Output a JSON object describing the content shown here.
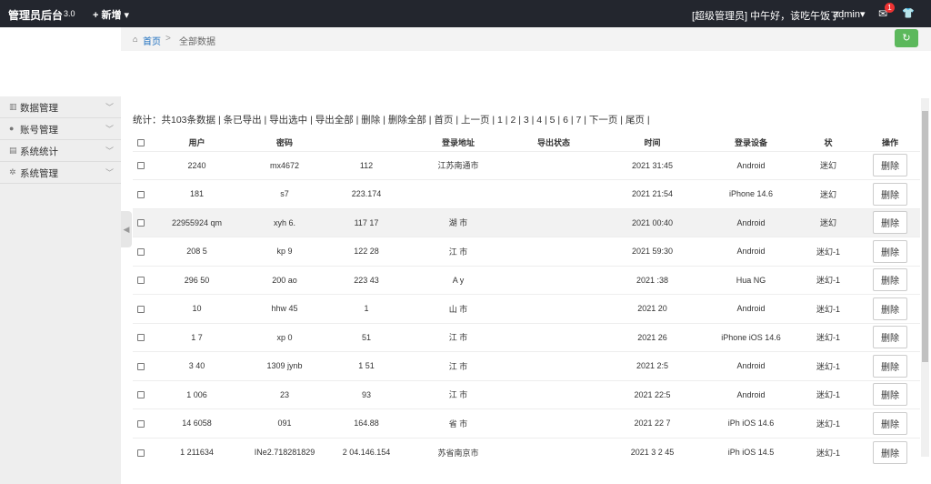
{
  "topbar": {
    "brand": "管理员后台",
    "version": "3.0",
    "new_label": "+ 新增 ▾",
    "greeting": "[超级管理员] 中午好，该吃午饭了！",
    "admin": "admin▾",
    "badge_count": "1"
  },
  "breadcrumb": {
    "home": "首页",
    "separator": ">",
    "current": "全部数据"
  },
  "sidebar": {
    "items": [
      {
        "label": "数据管理",
        "icon": "chart-icon"
      },
      {
        "label": "账号管理",
        "icon": "user-icon"
      },
      {
        "label": "系统统计",
        "icon": "stats-icon"
      },
      {
        "label": "系统管理",
        "icon": "gear-icon"
      }
    ]
  },
  "stats": {
    "count": "统计：共103条数据",
    "links": [
      "条已导出",
      "导出选中",
      "导出全部",
      "删除",
      "删除全部",
      "首页",
      "上一页",
      "1",
      "2",
      "3",
      "4",
      "5",
      "6",
      "7",
      "下一页",
      "尾页"
    ]
  },
  "table": {
    "headers": [
      "用户",
      "密码",
      "",
      "登录地址",
      "导出状态",
      "时间",
      "登录设备",
      "状",
      "操作"
    ],
    "delete_label": "删除",
    "rows": [
      [
        "2240",
        "mx4672",
        "112",
        "江苏南通市",
        "",
        "2021 31:45",
        "Android",
        "迷幻",
        ""
      ],
      [
        "181",
        "s7",
        "223.174",
        "",
        "",
        "2021 21:54",
        "iPhone 14.6",
        "迷幻",
        ""
      ],
      [
        "22955924 qm",
        "xyh 6.",
        "117 17",
        "湖 市",
        "",
        "2021 00:40",
        "Android",
        "迷幻",
        ""
      ],
      [
        "208 5",
        "kp 9",
        "122 28",
        "江 市",
        "",
        "2021 59:30",
        "Android",
        "迷幻-1",
        ""
      ],
      [
        "296 50",
        "200 ao",
        "223 43",
        "A y",
        "",
        "2021 :38",
        "Hua NG",
        "迷幻-1",
        ""
      ],
      [
        "10",
        "hhw 45",
        "1",
        "山 市",
        "",
        "2021 20",
        "Android",
        "迷幻-1",
        ""
      ],
      [
        "1 7",
        "xp 0",
        "51",
        "江 市",
        "",
        "2021 26",
        "iPhone iOS 14.6",
        "迷幻-1",
        ""
      ],
      [
        "3 40",
        "1309 jynb",
        "1 51",
        "江 市",
        "",
        "2021 2:5",
        "Android",
        "迷幻-1",
        ""
      ],
      [
        "1 006",
        "23",
        "93",
        "江 市",
        "",
        "2021 22:5",
        "Android",
        "迷幻-1",
        ""
      ],
      [
        "14 6058",
        "091",
        "164.88",
        "省 市",
        "",
        "2021 22 7",
        "iPh iOS 14.6",
        "迷幻-1",
        ""
      ],
      [
        "1 211634",
        "INe2.718281829",
        "2 04.146.154",
        "苏省南京市",
        "",
        "2021 3 2 45",
        "iPh iOS 14.5",
        "迷幻-1",
        ""
      ]
    ],
    "highlight_row": 2
  },
  "colors": {
    "topbar": "#23262e",
    "link": "#1e6fbf",
    "refresh": "#5cb85c",
    "badge": "#ee3333"
  }
}
